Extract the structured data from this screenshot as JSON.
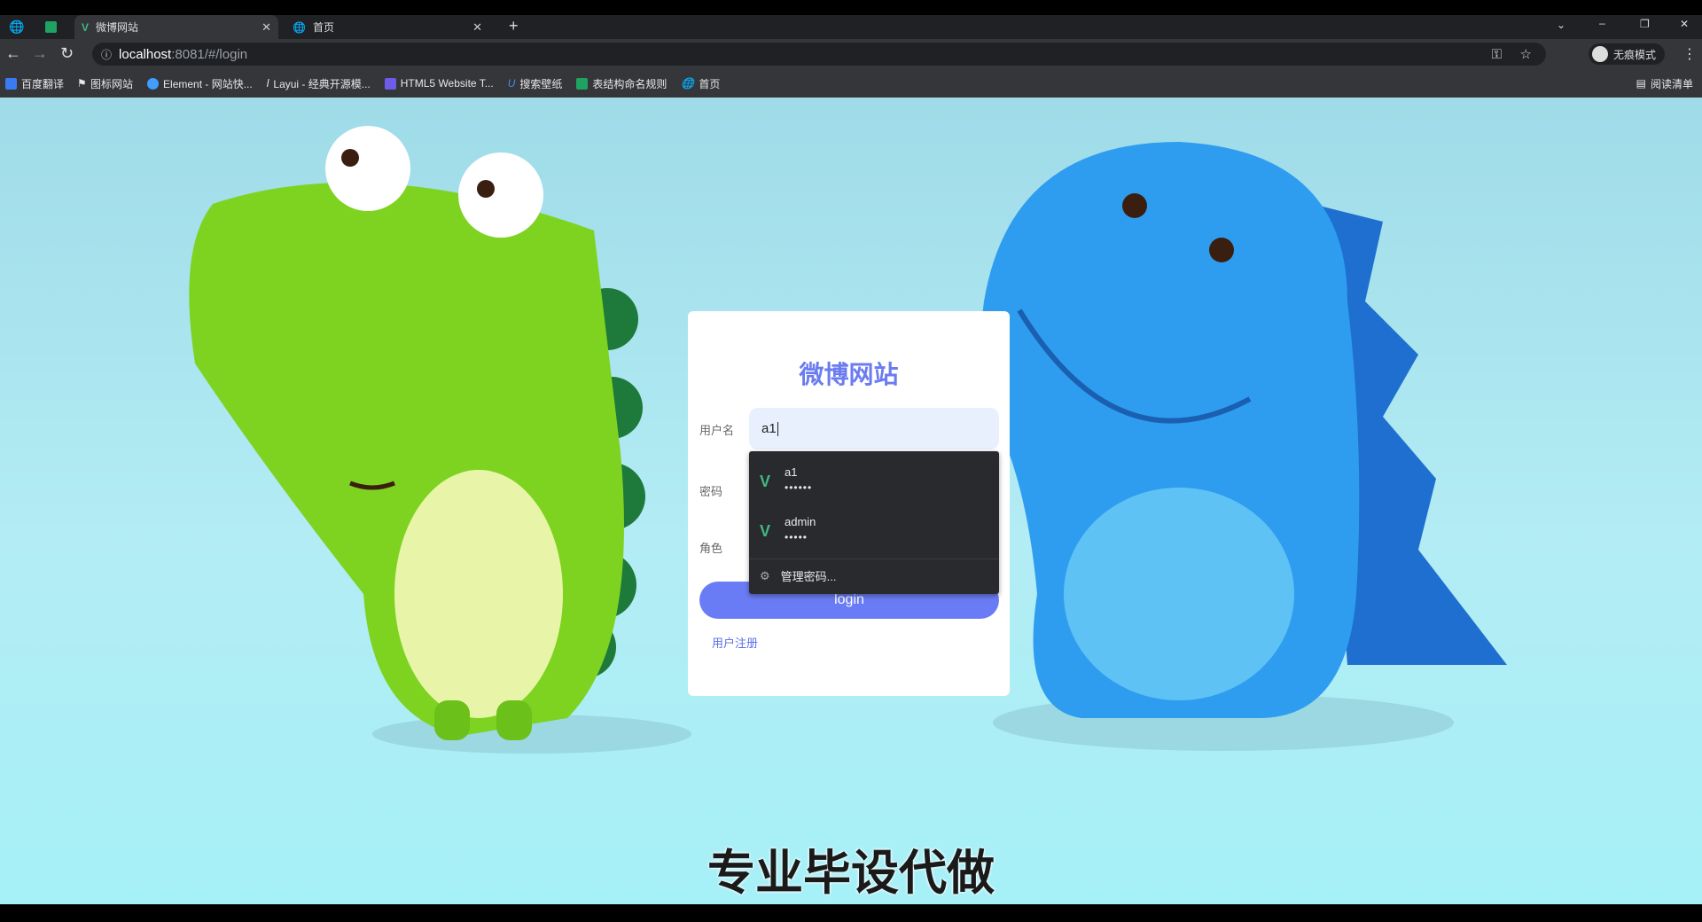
{
  "browser": {
    "tabs": [
      {
        "title": "微博网站",
        "active": true
      },
      {
        "title": "首页",
        "active": false
      }
    ],
    "url_host": "localhost",
    "url_path": ":8081/#/login",
    "profile_label": "无痕模式",
    "bookmarks": [
      "百度翻译",
      "图标网站",
      "Element - 网站快...",
      "Layui - 经典开源模...",
      "HTML5 Website T...",
      "搜索壁纸",
      "表结构命名规则",
      "首页"
    ],
    "reading_list": "阅读清单"
  },
  "login": {
    "title": "微博网站",
    "username_label": "用户名",
    "username_value": "a1",
    "password_label": "密码",
    "role_label": "角色",
    "login_button": "login",
    "register_link": "用户注册"
  },
  "autofill": {
    "entries": [
      {
        "user": "a1",
        "password": "••••••"
      },
      {
        "user": "admin",
        "password": "•••••"
      }
    ],
    "manage": "管理密码..."
  },
  "subtitle": "专业毕设代做",
  "colors": {
    "accent": "#6a7cf5",
    "vue": "#41b883"
  }
}
